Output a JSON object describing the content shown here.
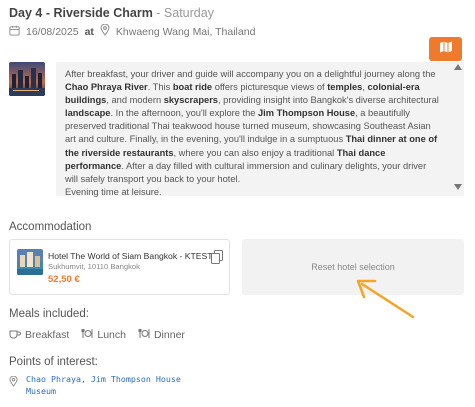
{
  "header": {
    "day_title": "Day 4 - Riverside Charm",
    "separator": " - ",
    "day_of_week": "Saturday",
    "date": "16/08/2025",
    "at_label": "at",
    "location": "Khwaeng Wang Mai, Thailand"
  },
  "description": {
    "segments": [
      {
        "t": "After breakfast, your driver and guide will accompany you on a delightful journey along the ",
        "b": false
      },
      {
        "t": "Chao Phraya River",
        "b": true
      },
      {
        "t": ". This ",
        "b": false
      },
      {
        "t": "boat ride",
        "b": true
      },
      {
        "t": " offers picturesque views of ",
        "b": false
      },
      {
        "t": "temples",
        "b": true
      },
      {
        "t": ", ",
        "b": false
      },
      {
        "t": "colonial-era buildings",
        "b": true
      },
      {
        "t": ", and modern ",
        "b": false
      },
      {
        "t": "skyscrapers",
        "b": true
      },
      {
        "t": ", providing insight into Bangkok's diverse architectural ",
        "b": false
      },
      {
        "t": "landscape",
        "b": true
      },
      {
        "t": ". In the afternoon, you'll explore the ",
        "b": false
      },
      {
        "t": "Jim Thompson House",
        "b": true
      },
      {
        "t": ", a beautifully preserved traditional Thai teakwood house turned museum, showcasing Southeast Asian art and culture. Finally, in the evening, you'll indulge in a sumptuous ",
        "b": false
      },
      {
        "t": "Thai dinner at one of the riverside restaurants",
        "b": true
      },
      {
        "t": ", where you can also enjoy a traditional ",
        "b": false
      },
      {
        "t": "Thai dance performance",
        "b": true
      },
      {
        "t": ". After a day filled with cultural immersion and culinary delights, your driver will safely transport you back to your hotel.",
        "b": false
      }
    ],
    "footer_line": "Evening time at leisure."
  },
  "accommodation": {
    "section_label": "Accommodation",
    "hotel_name": "Hotel The World of Siam Bangkok - KTEST",
    "hotel_address": "Sukhumvit, 10110 Bangkok",
    "hotel_price": "52,50 €",
    "reset_label": "Reset hotel selection"
  },
  "meals": {
    "section_label": "Meals included:",
    "items": [
      "Breakfast",
      "Lunch",
      "Dinner"
    ]
  },
  "poi": {
    "section_label": "Points of interest:",
    "text": "Chao Phraya, Jim Thompson House Museum"
  },
  "colors": {
    "accent": "#f07a2c",
    "link": "#2a6eb8",
    "panel": "#f3f3f3"
  },
  "icons": [
    "calendar-icon",
    "location-pin-icon",
    "map-icon",
    "copy-icon",
    "coffee-icon",
    "cutlery-icon",
    "arrow-annotation"
  ]
}
